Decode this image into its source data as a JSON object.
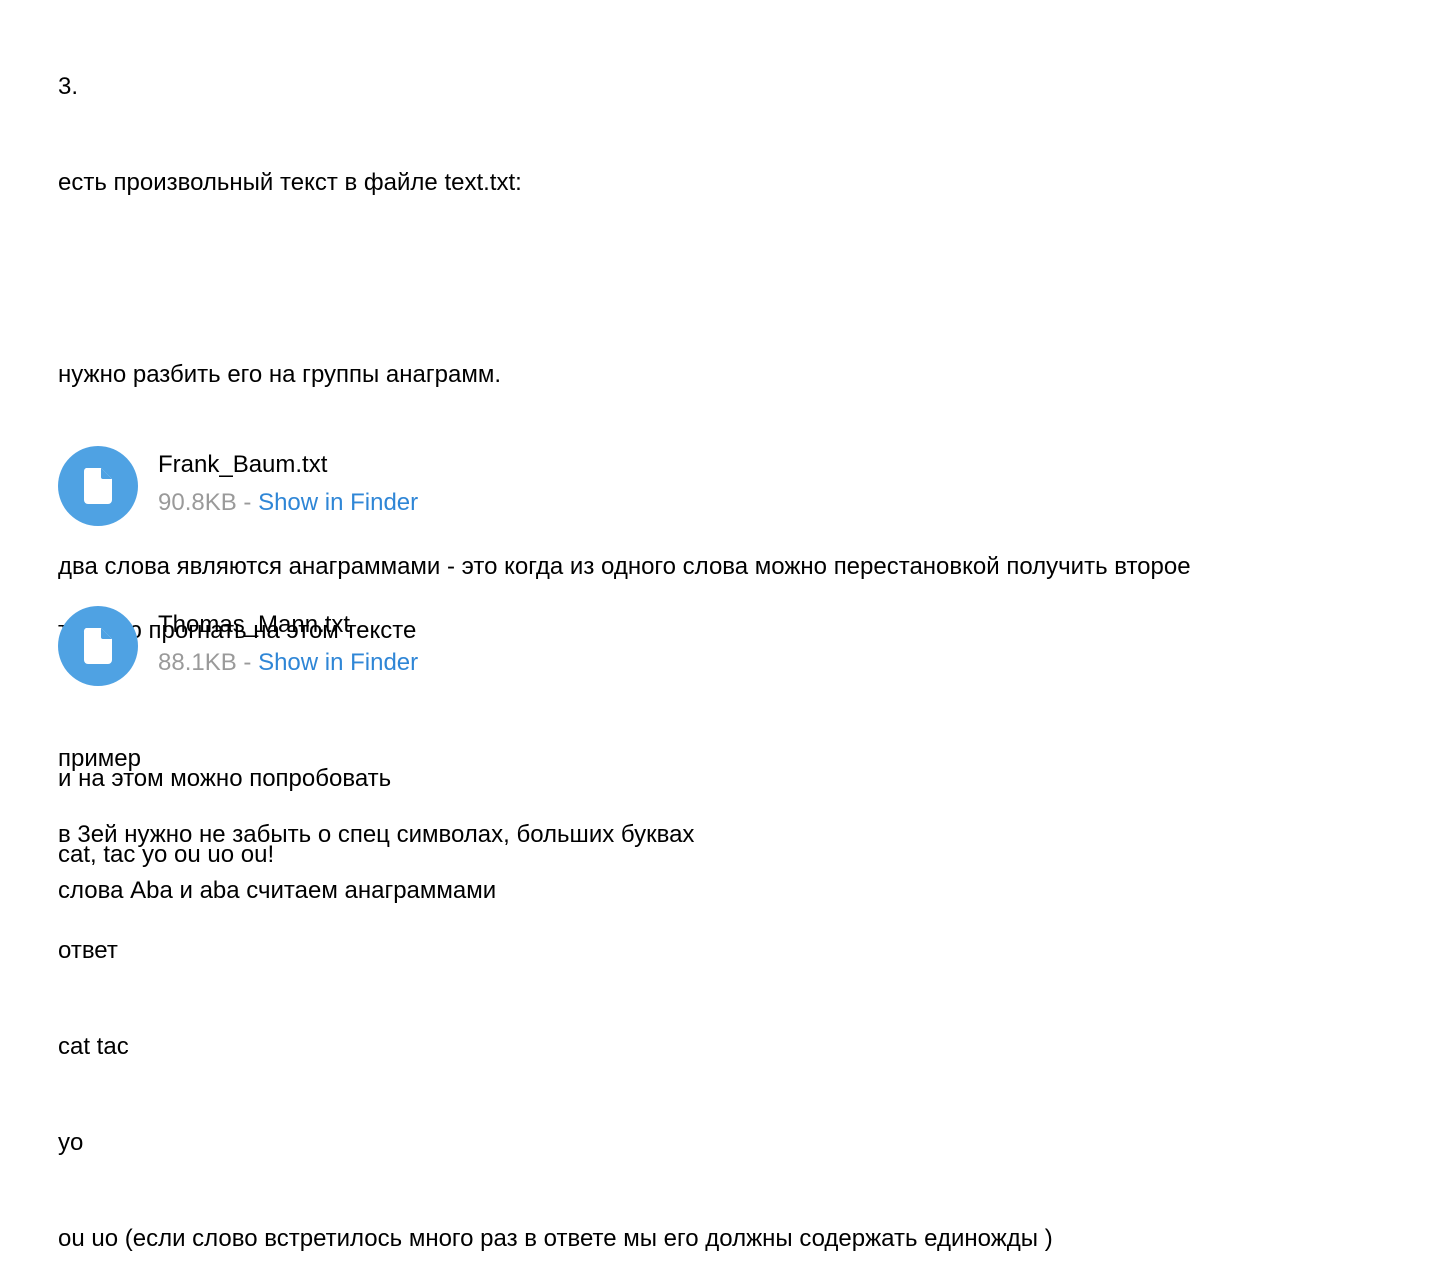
{
  "message1": {
    "lines": [
      "3.",
      "есть произвольный текст в файле text.txt:",
      "",
      "нужно разбить его на группы анаграмм.",
      "",
      "два слова являются анаграммами - это когда из одного слова можно перестановкой получить второе",
      "",
      "пример",
      "cat, tac yo ou uo ou!",
      "ответ",
      "cat tac",
      "yo",
      "ou uo (если слово встретилось много раз в ответе мы его должны содержать единожды )"
    ]
  },
  "file1": {
    "icon": "document-icon",
    "name": "Frank_Baum.txt",
    "size": "90.8KB",
    "separator": " - ",
    "link": "Show in Finder"
  },
  "message2": {
    "text": "третюю прогнать на этом тексте"
  },
  "file2": {
    "icon": "document-icon",
    "name": "Thomas_Mann.txt",
    "size": "88.1KB",
    "separator": " - ",
    "link": "Show in Finder"
  },
  "message3": {
    "text": "и на этом можно попробовать"
  },
  "message4": {
    "text": "в 3ей нужно не забыть о спец символах, больших буквах"
  },
  "message5": {
    "text": "слова Aba и aba считаем анаграммами"
  },
  "colors": {
    "file_icon_bg": "#4fa2e3",
    "link": "#2f86d6",
    "meta_text": "#9a9a9a"
  }
}
